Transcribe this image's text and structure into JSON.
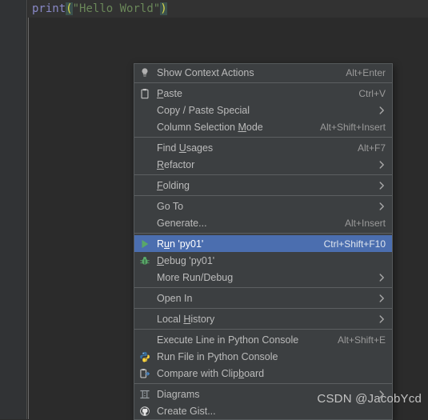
{
  "editor": {
    "code_tokens": [
      {
        "text": "print",
        "kind": "function"
      },
      {
        "text": "(",
        "kind": "paren"
      },
      {
        "text": "\"",
        "kind": "quote"
      },
      {
        "text": "Hello World",
        "kind": "string"
      },
      {
        "text": "\"",
        "kind": "quote"
      },
      {
        "text": ")",
        "kind": "paren"
      }
    ],
    "code_text": "print(\"Hello World\")",
    "background": "#2b2b2b",
    "active_line_color": "#323232",
    "gutter_color": "#313335"
  },
  "context_menu": {
    "background": "#3c3f41",
    "border_color": "#565a5c",
    "selection_color": "#4b6eaf",
    "groups": [
      {
        "items": [
          {
            "label": "Show Context Actions",
            "accel": "Alt+Enter",
            "icon": "lightbulb-icon",
            "arrow": false,
            "selected": false
          }
        ]
      },
      {
        "items": [
          {
            "label": "Paste",
            "mnemonic": "P",
            "accel": "Ctrl+V",
            "icon": "clipboard-paste-icon",
            "arrow": false,
            "selected": false
          },
          {
            "label": "Copy / Paste Special",
            "accel": "",
            "icon": "",
            "arrow": true,
            "selected": false
          },
          {
            "label": "Column Selection Mode",
            "mnemonic": "M",
            "accel": "Alt+Shift+Insert",
            "icon": "",
            "arrow": false,
            "selected": false
          }
        ]
      },
      {
        "items": [
          {
            "label": "Find Usages",
            "mnemonic": "U",
            "accel": "Alt+F7",
            "icon": "",
            "arrow": false,
            "selected": false
          },
          {
            "label": "Refactor",
            "mnemonic": "R",
            "accel": "",
            "icon": "",
            "arrow": true,
            "selected": false
          }
        ]
      },
      {
        "items": [
          {
            "label": "Folding",
            "mnemonic": "F",
            "accel": "",
            "icon": "",
            "arrow": true,
            "selected": false
          }
        ]
      },
      {
        "items": [
          {
            "label": "Go To",
            "accel": "",
            "icon": "",
            "arrow": true,
            "selected": false
          },
          {
            "label": "Generate...",
            "accel": "Alt+Insert",
            "icon": "",
            "arrow": false,
            "selected": false
          }
        ]
      },
      {
        "items": [
          {
            "label": "Run 'py01'",
            "mnemonic": "u",
            "accel": "Ctrl+Shift+F10",
            "icon": "run-play-icon",
            "arrow": false,
            "selected": true
          },
          {
            "label": "Debug 'py01'",
            "mnemonic": "D",
            "accel": "",
            "icon": "debug-bug-icon",
            "arrow": false,
            "selected": false
          },
          {
            "label": "More Run/Debug",
            "accel": "",
            "icon": "",
            "arrow": true,
            "selected": false
          }
        ]
      },
      {
        "items": [
          {
            "label": "Open In",
            "accel": "",
            "icon": "",
            "arrow": true,
            "selected": false
          }
        ]
      },
      {
        "items": [
          {
            "label": "Local History",
            "mnemonic": "H",
            "accel": "",
            "icon": "",
            "arrow": true,
            "selected": false
          }
        ]
      },
      {
        "items": [
          {
            "label": "Execute Line in Python Console",
            "accel": "Alt+Shift+E",
            "icon": "",
            "arrow": false,
            "selected": false
          },
          {
            "label": "Run File in Python Console",
            "accel": "",
            "icon": "python-logo-icon",
            "arrow": false,
            "selected": false
          },
          {
            "label": "Compare with Clipboard",
            "mnemonic": "b",
            "accel": "",
            "icon": "compare-clipboard-icon",
            "arrow": false,
            "selected": false
          }
        ]
      },
      {
        "items": [
          {
            "label": "Diagrams",
            "accel": "",
            "icon": "diagram-icon",
            "arrow": true,
            "selected": false
          },
          {
            "label": "Create Gist...",
            "accel": "",
            "icon": "github-icon",
            "arrow": false,
            "selected": false
          }
        ]
      }
    ]
  },
  "watermark": {
    "text": "CSDN @JacobYcd"
  }
}
